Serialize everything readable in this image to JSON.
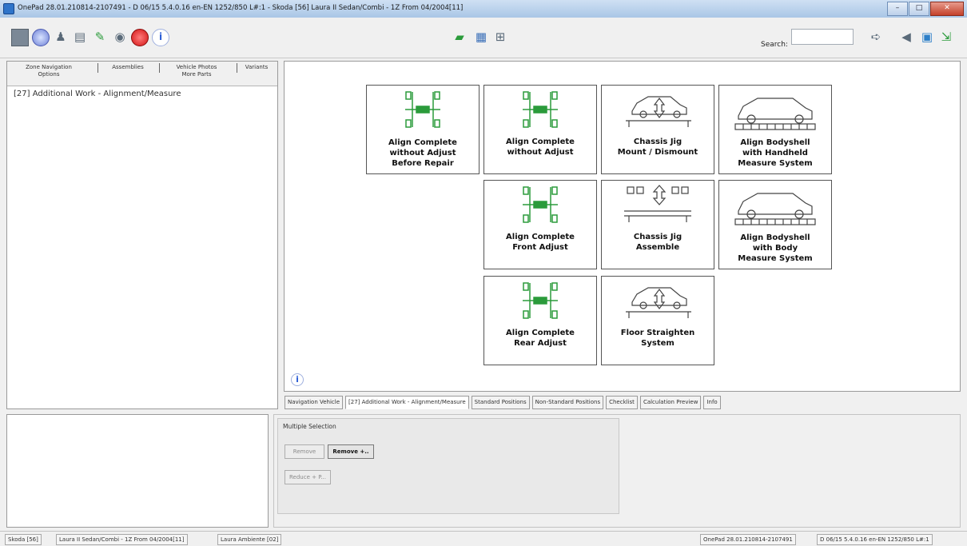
{
  "window": {
    "title": "OnePad 28.01.210814-2107491 - D 06/15 5.4.0.16 en-EN 1252/850 L#:1 - Skoda [56] Laura II Sedan/Combi - 1Z From 04/2004[11]",
    "min_label": "–",
    "max_label": "□",
    "close_label": "✕"
  },
  "toolbar": {
    "icons_left": [
      "stop-icon",
      "disc-icon",
      "person-icon",
      "clipboard-icon",
      "pencil-icon",
      "eye-icon",
      "wrench-icon",
      "info-icon"
    ],
    "icons_center": [
      "car-icon",
      "chart-icon",
      "grid-icon"
    ],
    "search_label": "Search:",
    "search_value": "",
    "icons_right": [
      "arrow-right-icon",
      "arrow-left-icon",
      "window-icon",
      "exit-icon"
    ]
  },
  "left_panel": {
    "tabs_row1": [
      "Zone Navigation",
      "Assemblies",
      "Vehicle Photos",
      "Variants"
    ],
    "tabs_row2": [
      "Options",
      "More Parts"
    ],
    "item": "[27] Additional Work - Alignment/Measure"
  },
  "cards": [
    {
      "label1": "Align Complete",
      "label2": "without Adjust",
      "label3": "Before Repair"
    },
    {
      "label1": "Align Complete",
      "label2": "without Adjust",
      "label3": ""
    },
    {
      "label1": "Chassis Jig",
      "label2": "Mount / Dismount",
      "label3": ""
    },
    {
      "label1": "Align Bodyshell",
      "label2": "with Handheld",
      "label3": "Measure System"
    },
    {
      "label1": "Align Complete",
      "label2": "Front Adjust",
      "label3": ""
    },
    {
      "label1": "Chassis Jig",
      "label2": "Assemble",
      "label3": ""
    },
    {
      "label1": "Align Bodyshell",
      "label2": "with Body",
      "label3": "Measure System"
    },
    {
      "label1": "Align Complete",
      "label2": "Rear Adjust",
      "label3": ""
    },
    {
      "label1": "Floor Straighten",
      "label2": "System",
      "label3": ""
    }
  ],
  "bottom_tabs": [
    "Navigation Vehicle",
    "[27] Additional Work - Alignment/Measure",
    "Standard Positions",
    "Non-Standard Positions",
    "Checklist",
    "Calculation Preview",
    "Info"
  ],
  "multiple_selection": {
    "label": "Multiple Selection",
    "remove": "Remove",
    "remove_plus": "Remove +..",
    "reduce": "Reduce + P..."
  },
  "status": {
    "make": "Skoda [56]",
    "model": "Laura II Sedan/Combi - 1Z From 04/2004[11]",
    "trim": "Laura Ambiente [02]",
    "version": "OnePad 28.01.210814-2107491",
    "locale": "D 06/15 5.4.0.16 en-EN 1252/850 L#:1"
  },
  "colors": {
    "accent_green": "#2b9b3b",
    "title_blue": "#a9c6e6"
  }
}
